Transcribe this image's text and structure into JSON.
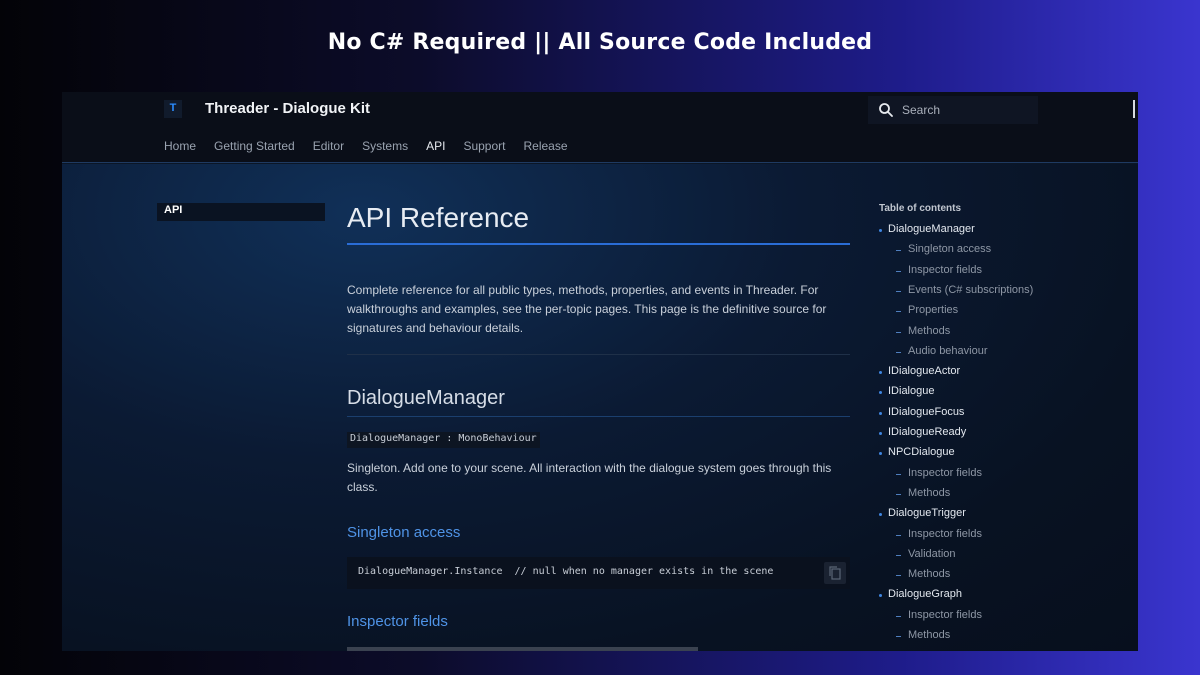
{
  "banner": {
    "text": "No C# Required || All Source Code Included"
  },
  "site": {
    "logo_letter": "T",
    "title": "Threader - Dialogue Kit",
    "search_placeholder": "Search"
  },
  "nav": {
    "items": [
      {
        "label": "Home",
        "active": false
      },
      {
        "label": "Getting Started",
        "active": false
      },
      {
        "label": "Editor",
        "active": false
      },
      {
        "label": "Systems",
        "active": false
      },
      {
        "label": "API",
        "active": true
      },
      {
        "label": "Support",
        "active": false
      },
      {
        "label": "Release",
        "active": false
      }
    ]
  },
  "sidebar": {
    "current": "API"
  },
  "main": {
    "title": "API Reference",
    "intro_lines": [
      "Complete reference for all public types, methods, properties, and events in Threader. For",
      "walkthroughs and examples, see the per-topic pages. This page is the definitive source for",
      "signatures and behaviour details."
    ],
    "section_heading": "DialogueManager",
    "signature": "DialogueManager : MonoBehaviour",
    "section_desc_lines": [
      "Singleton. Add one to your scene. All interaction with the dialogue system goes through this",
      "class."
    ],
    "sub_heading_1": "Singleton access",
    "code_line": "DialogueManager.Instance  // null when no manager exists in the scene",
    "sub_heading_2": "Inspector fields"
  },
  "toc": {
    "title": "Table of contents",
    "items": [
      {
        "label": "DialogueManager",
        "level": 1
      },
      {
        "label": "Singleton access",
        "level": 2
      },
      {
        "label": "Inspector fields",
        "level": 2
      },
      {
        "label": "Events (C# subscriptions)",
        "level": 2
      },
      {
        "label": "Properties",
        "level": 2
      },
      {
        "label": "Methods",
        "level": 2
      },
      {
        "label": "Audio behaviour",
        "level": 2
      },
      {
        "label": "IDialogueActor",
        "level": 1
      },
      {
        "label": "IDialogue",
        "level": 1
      },
      {
        "label": "IDialogueFocus",
        "level": 1
      },
      {
        "label": "IDialogueReady",
        "level": 1
      },
      {
        "label": "NPCDialogue",
        "level": 1
      },
      {
        "label": "Inspector fields",
        "level": 2
      },
      {
        "label": "Methods",
        "level": 2
      },
      {
        "label": "DialogueTrigger",
        "level": 1
      },
      {
        "label": "Inspector fields",
        "level": 2
      },
      {
        "label": "Validation",
        "level": 2
      },
      {
        "label": "Methods",
        "level": 2
      },
      {
        "label": "DialogueGraph",
        "level": 1
      },
      {
        "label": "Inspector fields",
        "level": 2
      },
      {
        "label": "Methods",
        "level": 2
      }
    ]
  }
}
